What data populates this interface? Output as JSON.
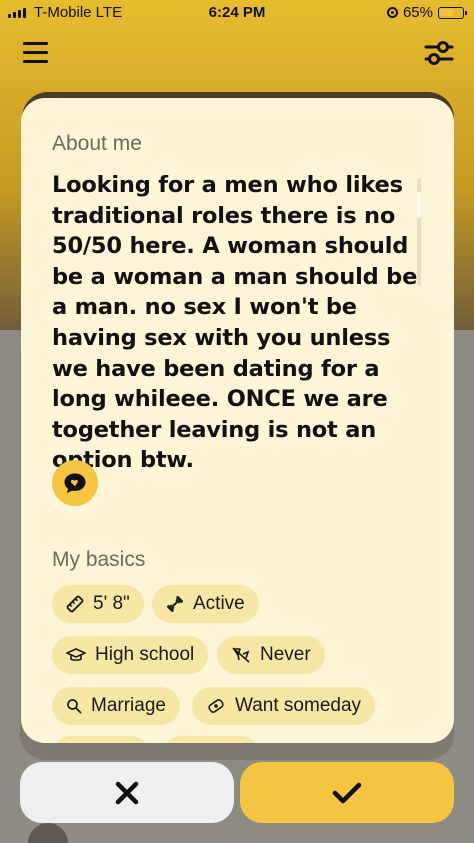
{
  "status_bar": {
    "carrier": "T-Mobile  LTE",
    "time": "6:24 PM",
    "battery": "65%",
    "battery_level": 0.65
  },
  "profile": {
    "about_heading": "About me",
    "bio": "Looking for a men who likes traditional roles there is no 50/50 here. A woman should be a woman a man should be a man. no sex I won't be having sex with you unless we have been dating for a long whileee. ONCE we are together leaving is not an option btw.",
    "basics_heading": "My basics",
    "basics": [
      {
        "icon": "ruler-icon",
        "label": "5' 8\""
      },
      {
        "icon": "dumbbell-icon",
        "label": "Active"
      },
      {
        "icon": "graduation-cap-icon",
        "label": "High school"
      },
      {
        "icon": "no-drinking-icon",
        "label": "Never"
      },
      {
        "icon": "search-icon",
        "label": "Marriage"
      },
      {
        "icon": "pacifier-icon",
        "label": "Want someday"
      }
    ]
  },
  "actions": {
    "pass": "pass-x-icon",
    "like": "checkmark-icon"
  },
  "colors": {
    "accent": "#f5c541",
    "card": "#fdf5d6",
    "chip": "#f7e6a4"
  }
}
